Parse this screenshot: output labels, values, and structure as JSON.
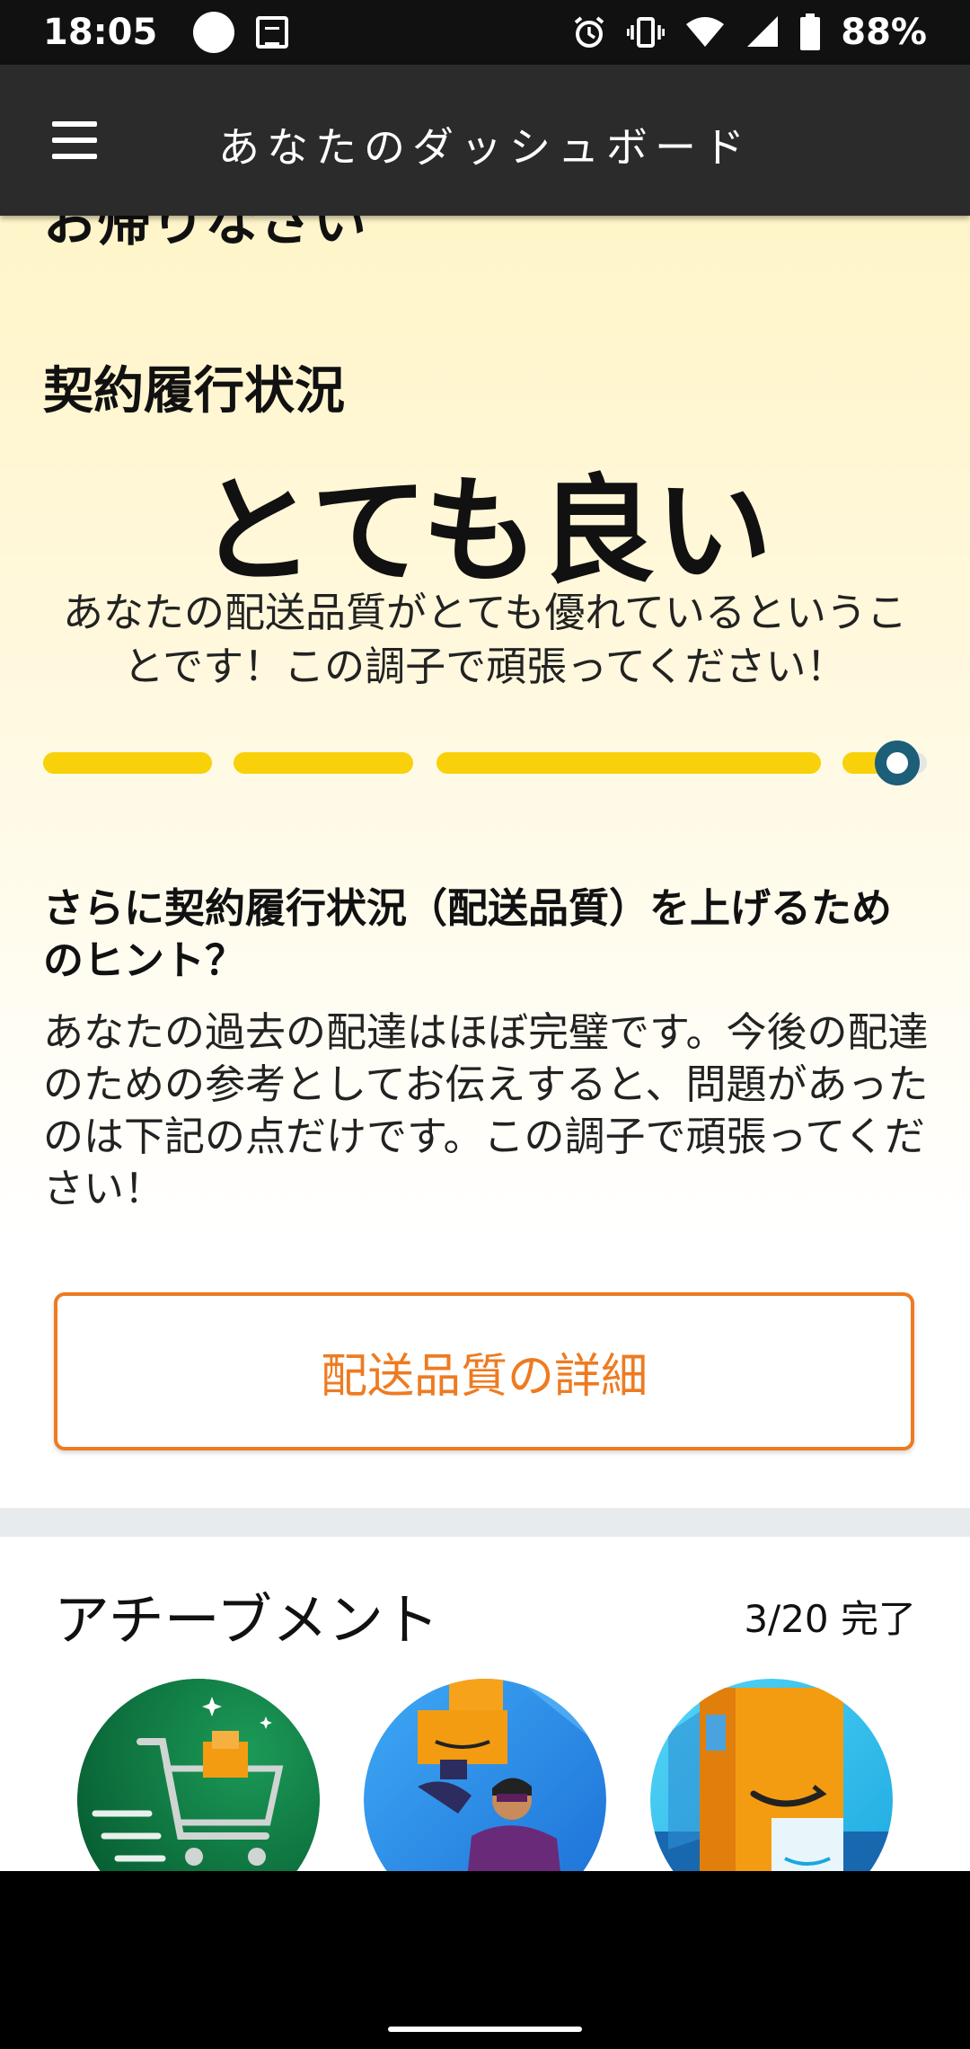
{
  "status_bar": {
    "time": "18:05",
    "battery": "88%",
    "icons": [
      "dot-icon",
      "news-icon",
      "alarm-icon",
      "vibrate-icon",
      "wifi-icon",
      "signal-icon",
      "battery-icon"
    ]
  },
  "app_bar": {
    "title": "あなたのダッシュボード",
    "menu_icon": "hamburger-menu-icon"
  },
  "dashboard": {
    "welcome": "お帰りなさい",
    "performance_label": "契約履行状況",
    "rating": "とても良い",
    "rating_description": "あなたの配送品質がとても優れているということです！この調子で頑張ってください！",
    "progress_level": 0.96,
    "tips_heading": "さらに契約履行状況（配送品質）を上げるためのヒント？",
    "tips_body": "あなたの過去の配達はほぼ完璧です。今後の配達のための参考としてお伝えすると、問題があったのは下記の点だけです。この調子で頑張ってください！",
    "detail_button": "配送品質の詳細"
  },
  "achievements": {
    "title": "アチーブメント",
    "count": "3/20 完了",
    "badges": [
      "shopping-cart-badge-icon",
      "hero-carrying-boxes-badge-icon",
      "amazon-box-badge-icon"
    ]
  },
  "colors": {
    "accent_orange": "#ee7b21",
    "progress_yellow": "#f8d10b",
    "marker_teal": "#1d5e78",
    "app_bar": "#2b2b2b"
  }
}
